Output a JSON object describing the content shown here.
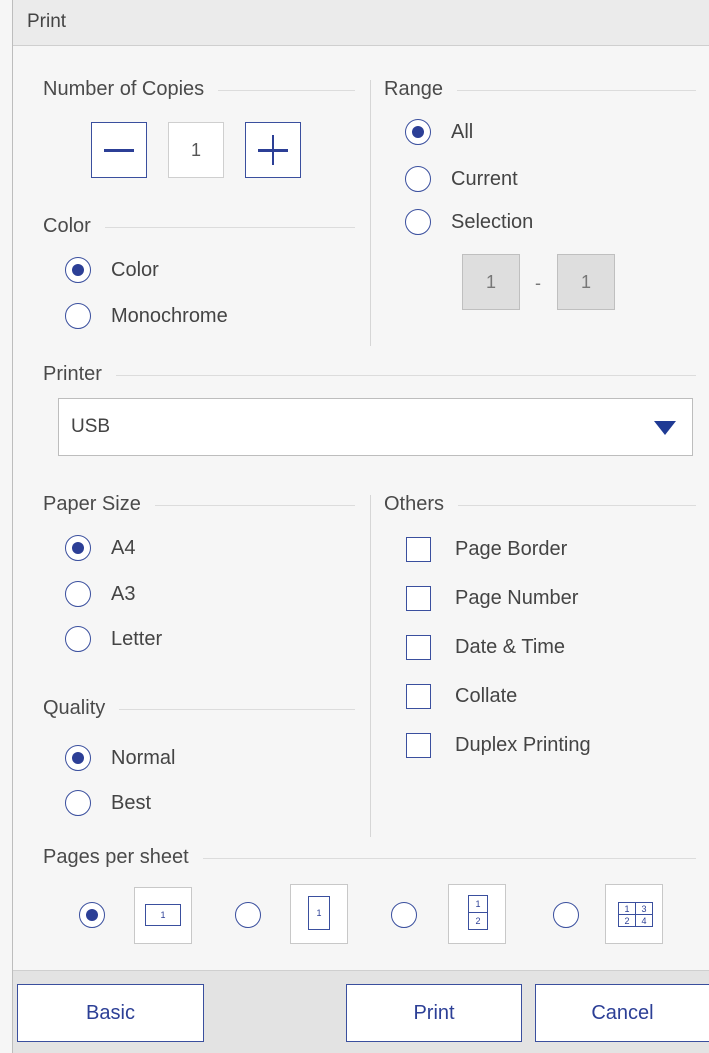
{
  "window": {
    "title": "Print"
  },
  "copies": {
    "label": "Number of Copies",
    "value": "1",
    "decrement_icon": "minus-icon",
    "increment_icon": "plus-icon"
  },
  "range": {
    "label": "Range",
    "options": [
      {
        "label": "All",
        "checked": true
      },
      {
        "label": "Current",
        "checked": false
      },
      {
        "label": "Selection",
        "checked": false
      }
    ],
    "from": "1",
    "separator": "-",
    "to": "1"
  },
  "color": {
    "label": "Color",
    "options": [
      {
        "label": "Color",
        "checked": true
      },
      {
        "label": "Monochrome",
        "checked": false
      }
    ]
  },
  "printer": {
    "label": "Printer",
    "selected": "USB",
    "dropdown_icon": "triangle-down-icon"
  },
  "paper_size": {
    "label": "Paper Size",
    "options": [
      {
        "label": "A4",
        "checked": true
      },
      {
        "label": "A3",
        "checked": false
      },
      {
        "label": "Letter",
        "checked": false
      }
    ]
  },
  "others": {
    "label": "Others",
    "options": [
      {
        "label": "Page Border",
        "checked": false
      },
      {
        "label": "Page Number",
        "checked": false
      },
      {
        "label": "Date & Time",
        "checked": false
      },
      {
        "label": "Collate",
        "checked": false
      },
      {
        "label": "Duplex Printing",
        "checked": false
      }
    ]
  },
  "quality": {
    "label": "Quality",
    "options": [
      {
        "label": "Normal",
        "checked": true
      },
      {
        "label": "Best",
        "checked": false
      }
    ]
  },
  "pages_per_sheet": {
    "label": "Pages per sheet",
    "options": [
      {
        "icon": "one-page-landscape-icon",
        "cells": [
          "1"
        ],
        "checked": true
      },
      {
        "icon": "one-page-portrait-icon",
        "cells": [
          "1"
        ],
        "checked": false
      },
      {
        "icon": "two-pages-icon",
        "cells": [
          "1",
          "2"
        ],
        "checked": false
      },
      {
        "icon": "four-pages-icon",
        "cells": [
          "1",
          "3",
          "2",
          "4"
        ],
        "checked": false
      }
    ]
  },
  "footer": {
    "basic_label": "Basic",
    "print_label": "Print",
    "cancel_label": "Cancel"
  },
  "colors": {
    "accent": "#2c3f96",
    "border": "#3a4f9e",
    "background": "#f6f6f6"
  }
}
